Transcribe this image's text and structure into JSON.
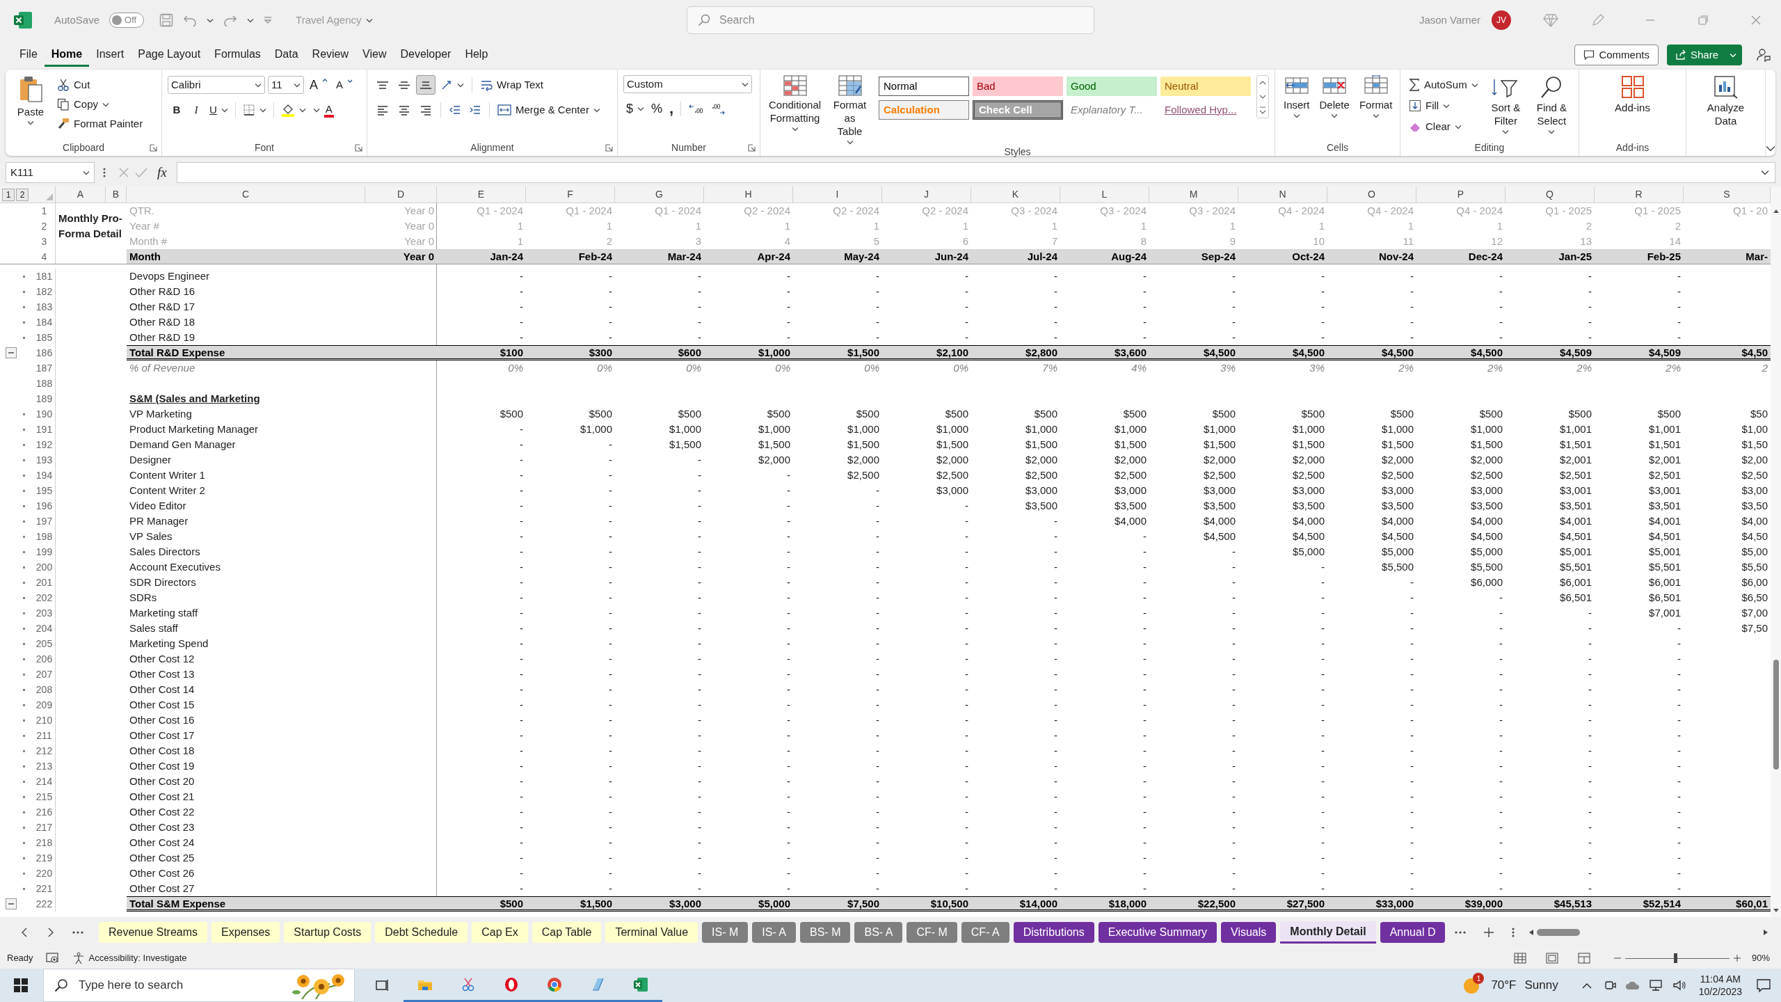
{
  "app": {
    "autosave": {
      "label": "AutoSave",
      "on": false,
      "state_text": "Off"
    },
    "document_title": "Travel Agency",
    "search_placeholder": "Search",
    "user_name": "Jason Varner",
    "user_initials": "JV"
  },
  "menu_tabs": [
    {
      "label": "File",
      "selected": false
    },
    {
      "label": "Home",
      "selected": true
    },
    {
      "label": "Insert",
      "selected": false
    },
    {
      "label": "Page Layout",
      "selected": false
    },
    {
      "label": "Formulas",
      "selected": false
    },
    {
      "label": "Data",
      "selected": false
    },
    {
      "label": "Review",
      "selected": false
    },
    {
      "label": "View",
      "selected": false
    },
    {
      "label": "Developer",
      "selected": false
    },
    {
      "label": "Help",
      "selected": false
    }
  ],
  "comments_button": "Comments",
  "share_button": "Share",
  "ribbon": {
    "clipboard": {
      "label": "Clipboard",
      "paste": "Paste",
      "cut": "Cut",
      "copy": "Copy",
      "format_painter": "Format Painter"
    },
    "font": {
      "label": "Font",
      "font_name": "Calibri",
      "font_size": "11",
      "grow": "A",
      "shrink": "A",
      "bold": "B",
      "italic": "I",
      "underline": "U",
      "font_color": "A"
    },
    "alignment": {
      "label": "Alignment",
      "vertical_align": [
        {
          "selected": false
        },
        {
          "selected": false
        },
        {
          "selected": true
        }
      ],
      "wrap_text": "Wrap Text",
      "merge_center": "Merge & Center"
    },
    "number": {
      "label": "Number",
      "format": "Custom",
      "currency": "$",
      "percent": "%",
      "comma": ","
    },
    "styles": {
      "label": "Styles",
      "conditional_formatting": "Conditional Formatting",
      "format_as_table": "Format as Table",
      "gallery": [
        {
          "kind": "normal",
          "label": "Normal"
        },
        {
          "kind": "bad",
          "label": "Bad"
        },
        {
          "kind": "good",
          "label": "Good"
        },
        {
          "kind": "neutral",
          "label": "Neutral"
        },
        {
          "kind": "calculation",
          "label": "Calculation"
        },
        {
          "kind": "check",
          "label": "Check Cell"
        },
        {
          "kind": "explanatory",
          "label": "Explanatory T..."
        },
        {
          "kind": "hyperlink",
          "label": "Followed Hyp..."
        }
      ]
    },
    "cells": {
      "label": "Cells",
      "insert": "Insert",
      "delete": "Delete",
      "format": "Format"
    },
    "editing": {
      "label": "Editing",
      "autosum": "AutoSum",
      "fill": "Fill",
      "clear": "Clear",
      "sort_filter": "Sort & Filter",
      "find_select": "Find & Select"
    },
    "addins": {
      "label": "Add-ins",
      "addins": "Add-ins"
    },
    "analyze_data": "Analyze Data"
  },
  "formula_bar": {
    "name_box": "K111",
    "fx": "fx"
  },
  "outline_levels": [
    "1",
    "2"
  ],
  "columns": [
    "A",
    "B",
    "C",
    "D",
    "E",
    "F",
    "G",
    "H",
    "I",
    "J",
    "K",
    "L",
    "M",
    "N",
    "O",
    "P",
    "Q",
    "R",
    "S"
  ],
  "title_cell": "Monthly Pro-Forma Detail",
  "header_rows": [
    {
      "num": "1",
      "kind": "meta",
      "label": "QTR.",
      "d": "Year 0",
      "values": [
        "Q1 - 2024",
        "Q1 - 2024",
        "Q1 - 2024",
        "Q2 - 2024",
        "Q2 - 2024",
        "Q2 - 2024",
        "Q3 - 2024",
        "Q3 - 2024",
        "Q3 - 2024",
        "Q4 - 2024",
        "Q4 - 2024",
        "Q4 - 2024",
        "Q1 - 2025",
        "Q1 - 2025",
        "Q1 - 20"
      ]
    },
    {
      "num": "2",
      "kind": "meta",
      "label": "Year #",
      "d": "Year 0",
      "values": [
        "1",
        "1",
        "1",
        "1",
        "1",
        "1",
        "1",
        "1",
        "1",
        "1",
        "1",
        "1",
        "2",
        "2"
      ]
    },
    {
      "num": "3",
      "kind": "meta",
      "label": "Month #",
      "d": "Year 0",
      "values": [
        "1",
        "2",
        "3",
        "4",
        "5",
        "6",
        "7",
        "8",
        "9",
        "10",
        "11",
        "12",
        "13",
        "14"
      ]
    },
    {
      "num": "4",
      "kind": "month",
      "label": "Month",
      "d": "Year 0",
      "values": [
        "Jan-24",
        "Feb-24",
        "Mar-24",
        "Apr-24",
        "May-24",
        "Jun-24",
        "Jul-24",
        "Aug-24",
        "Sep-24",
        "Oct-24",
        "Nov-24",
        "Dec-24",
        "Jan-25",
        "Feb-25",
        "Mar-"
      ]
    }
  ],
  "rows": [
    {
      "num": "181",
      "kind": "item",
      "grouped": true,
      "collapse_button": false,
      "label": "Devops Engineer",
      "values": [
        "-",
        "-",
        "-",
        "-",
        "-",
        "-",
        "-",
        "-",
        "-",
        "-",
        "-",
        "-",
        "-",
        "-"
      ]
    },
    {
      "num": "182",
      "kind": "item",
      "grouped": true,
      "collapse_button": false,
      "label": "Other R&D 16",
      "values": [
        "-",
        "-",
        "-",
        "-",
        "-",
        "-",
        "-",
        "-",
        "-",
        "-",
        "-",
        "-",
        "-",
        "-"
      ]
    },
    {
      "num": "183",
      "kind": "item",
      "grouped": true,
      "collapse_button": false,
      "label": "Other R&D 17",
      "values": [
        "-",
        "-",
        "-",
        "-",
        "-",
        "-",
        "-",
        "-",
        "-",
        "-",
        "-",
        "-",
        "-",
        "-"
      ]
    },
    {
      "num": "184",
      "kind": "item",
      "grouped": true,
      "collapse_button": false,
      "label": "Other R&D 18",
      "values": [
        "-",
        "-",
        "-",
        "-",
        "-",
        "-",
        "-",
        "-",
        "-",
        "-",
        "-",
        "-",
        "-",
        "-"
      ]
    },
    {
      "num": "185",
      "kind": "item",
      "grouped": true,
      "collapse_button": false,
      "label": "Other R&D 19",
      "values": [
        "-",
        "-",
        "-",
        "-",
        "-",
        "-",
        "-",
        "-",
        "-",
        "-",
        "-",
        "-",
        "-",
        "-"
      ]
    },
    {
      "num": "186",
      "kind": "total",
      "grouped": false,
      "collapse_button": true,
      "label": "Total R&D Expense",
      "values": [
        "$100",
        "$300",
        "$600",
        "$1,000",
        "$1,500",
        "$2,100",
        "$2,800",
        "$3,600",
        "$4,500",
        "$4,500",
        "$4,500",
        "$4,500",
        "$4,509",
        "$4,509",
        "$4,50"
      ]
    },
    {
      "num": "187",
      "kind": "percent",
      "grouped": false,
      "collapse_button": false,
      "label": "% of Revenue",
      "values": [
        "0%",
        "0%",
        "0%",
        "0%",
        "0%",
        "0%",
        "7%",
        "4%",
        "3%",
        "3%",
        "2%",
        "2%",
        "2%",
        "2%",
        "2"
      ]
    },
    {
      "num": "188",
      "kind": "blank",
      "grouped": false,
      "collapse_button": false
    },
    {
      "num": "189",
      "kind": "section",
      "grouped": false,
      "collapse_button": false,
      "label": "S&M (Sales and Marketing"
    },
    {
      "num": "190",
      "kind": "item",
      "grouped": true,
      "collapse_button": false,
      "label": "VP Marketing",
      "values": [
        "$500",
        "$500",
        "$500",
        "$500",
        "$500",
        "$500",
        "$500",
        "$500",
        "$500",
        "$500",
        "$500",
        "$500",
        "$500",
        "$500",
        "$50"
      ]
    },
    {
      "num": "191",
      "kind": "item",
      "grouped": true,
      "collapse_button": false,
      "label": "Product Marketing Manager",
      "values": [
        "-",
        "$1,000",
        "$1,000",
        "$1,000",
        "$1,000",
        "$1,000",
        "$1,000",
        "$1,000",
        "$1,000",
        "$1,000",
        "$1,000",
        "$1,000",
        "$1,001",
        "$1,001",
        "$1,00"
      ]
    },
    {
      "num": "192",
      "kind": "item",
      "grouped": true,
      "collapse_button": false,
      "label": "Demand Gen Manager",
      "values": [
        "-",
        "-",
        "$1,500",
        "$1,500",
        "$1,500",
        "$1,500",
        "$1,500",
        "$1,500",
        "$1,500",
        "$1,500",
        "$1,500",
        "$1,500",
        "$1,501",
        "$1,501",
        "$1,50"
      ]
    },
    {
      "num": "193",
      "kind": "item",
      "grouped": true,
      "collapse_button": false,
      "label": "Designer",
      "values": [
        "-",
        "-",
        "-",
        "$2,000",
        "$2,000",
        "$2,000",
        "$2,000",
        "$2,000",
        "$2,000",
        "$2,000",
        "$2,000",
        "$2,000",
        "$2,001",
        "$2,001",
        "$2,00"
      ]
    },
    {
      "num": "194",
      "kind": "item",
      "grouped": true,
      "collapse_button": false,
      "label": "Content Writer 1",
      "values": [
        "-",
        "-",
        "-",
        "-",
        "$2,500",
        "$2,500",
        "$2,500",
        "$2,500",
        "$2,500",
        "$2,500",
        "$2,500",
        "$2,500",
        "$2,501",
        "$2,501",
        "$2,50"
      ]
    },
    {
      "num": "195",
      "kind": "item",
      "grouped": true,
      "collapse_button": false,
      "label": "Content Writer 2",
      "values": [
        "-",
        "-",
        "-",
        "-",
        "-",
        "$3,000",
        "$3,000",
        "$3,000",
        "$3,000",
        "$3,000",
        "$3,000",
        "$3,000",
        "$3,001",
        "$3,001",
        "$3,00"
      ]
    },
    {
      "num": "196",
      "kind": "item",
      "grouped": true,
      "collapse_button": false,
      "label": "Video Editor",
      "values": [
        "-",
        "-",
        "-",
        "-",
        "-",
        "-",
        "$3,500",
        "$3,500",
        "$3,500",
        "$3,500",
        "$3,500",
        "$3,500",
        "$3,501",
        "$3,501",
        "$3,50"
      ]
    },
    {
      "num": "197",
      "kind": "item",
      "grouped": true,
      "collapse_button": false,
      "label": "PR Manager",
      "values": [
        "-",
        "-",
        "-",
        "-",
        "-",
        "-",
        "-",
        "$4,000",
        "$4,000",
        "$4,000",
        "$4,000",
        "$4,000",
        "$4,001",
        "$4,001",
        "$4,00"
      ]
    },
    {
      "num": "198",
      "kind": "item",
      "grouped": true,
      "collapse_button": false,
      "label": "VP Sales",
      "values": [
        "-",
        "-",
        "-",
        "-",
        "-",
        "-",
        "-",
        "-",
        "$4,500",
        "$4,500",
        "$4,500",
        "$4,500",
        "$4,501",
        "$4,501",
        "$4,50"
      ]
    },
    {
      "num": "199",
      "kind": "item",
      "grouped": true,
      "collapse_button": false,
      "label": "Sales Directors",
      "values": [
        "-",
        "-",
        "-",
        "-",
        "-",
        "-",
        "-",
        "-",
        "-",
        "$5,000",
        "$5,000",
        "$5,000",
        "$5,001",
        "$5,001",
        "$5,00"
      ]
    },
    {
      "num": "200",
      "kind": "item",
      "grouped": true,
      "collapse_button": false,
      "label": "Account Executives",
      "values": [
        "-",
        "-",
        "-",
        "-",
        "-",
        "-",
        "-",
        "-",
        "-",
        "-",
        "$5,500",
        "$5,500",
        "$5,501",
        "$5,501",
        "$5,50"
      ]
    },
    {
      "num": "201",
      "kind": "item",
      "grouped": true,
      "collapse_button": false,
      "label": "SDR Directors",
      "values": [
        "-",
        "-",
        "-",
        "-",
        "-",
        "-",
        "-",
        "-",
        "-",
        "-",
        "-",
        "$6,000",
        "$6,001",
        "$6,001",
        "$6,00"
      ]
    },
    {
      "num": "202",
      "kind": "item",
      "grouped": true,
      "collapse_button": false,
      "label": "SDRs",
      "values": [
        "-",
        "-",
        "-",
        "-",
        "-",
        "-",
        "-",
        "-",
        "-",
        "-",
        "-",
        "-",
        "$6,501",
        "$6,501",
        "$6,50"
      ]
    },
    {
      "num": "203",
      "kind": "item",
      "grouped": true,
      "collapse_button": false,
      "label": "Marketing staff",
      "values": [
        "-",
        "-",
        "-",
        "-",
        "-",
        "-",
        "-",
        "-",
        "-",
        "-",
        "-",
        "-",
        "-",
        "$7,001",
        "$7,00"
      ]
    },
    {
      "num": "204",
      "kind": "item",
      "grouped": true,
      "collapse_button": false,
      "label": "Sales staff",
      "values": [
        "-",
        "-",
        "-",
        "-",
        "-",
        "-",
        "-",
        "-",
        "-",
        "-",
        "-",
        "-",
        "-",
        "-",
        "$7,50"
      ]
    },
    {
      "num": "205",
      "kind": "item",
      "grouped": true,
      "collapse_button": false,
      "label": "Marketing Spend",
      "values": [
        "-",
        "-",
        "-",
        "-",
        "-",
        "-",
        "-",
        "-",
        "-",
        "-",
        "-",
        "-",
        "-",
        "-"
      ]
    },
    {
      "num": "206",
      "kind": "item",
      "grouped": true,
      "collapse_button": false,
      "label": "Other Cost 12",
      "values": [
        "-",
        "-",
        "-",
        "-",
        "-",
        "-",
        "-",
        "-",
        "-",
        "-",
        "-",
        "-",
        "-",
        "-"
      ]
    },
    {
      "num": "207",
      "kind": "item",
      "grouped": true,
      "collapse_button": false,
      "label": "Other Cost 13",
      "values": [
        "-",
        "-",
        "-",
        "-",
        "-",
        "-",
        "-",
        "-",
        "-",
        "-",
        "-",
        "-",
        "-",
        "-"
      ]
    },
    {
      "num": "208",
      "kind": "item",
      "grouped": true,
      "collapse_button": false,
      "label": "Other Cost 14",
      "values": [
        "-",
        "-",
        "-",
        "-",
        "-",
        "-",
        "-",
        "-",
        "-",
        "-",
        "-",
        "-",
        "-",
        "-"
      ]
    },
    {
      "num": "209",
      "kind": "item",
      "grouped": true,
      "collapse_button": false,
      "label": "Other Cost 15",
      "values": [
        "-",
        "-",
        "-",
        "-",
        "-",
        "-",
        "-",
        "-",
        "-",
        "-",
        "-",
        "-",
        "-",
        "-"
      ]
    },
    {
      "num": "210",
      "kind": "item",
      "grouped": true,
      "collapse_button": false,
      "label": "Other Cost 16",
      "values": [
        "-",
        "-",
        "-",
        "-",
        "-",
        "-",
        "-",
        "-",
        "-",
        "-",
        "-",
        "-",
        "-",
        "-"
      ]
    },
    {
      "num": "211",
      "kind": "item",
      "grouped": true,
      "collapse_button": false,
      "label": "Other Cost 17",
      "values": [
        "-",
        "-",
        "-",
        "-",
        "-",
        "-",
        "-",
        "-",
        "-",
        "-",
        "-",
        "-",
        "-",
        "-"
      ]
    },
    {
      "num": "212",
      "kind": "item",
      "grouped": true,
      "collapse_button": false,
      "label": "Other Cost 18",
      "values": [
        "-",
        "-",
        "-",
        "-",
        "-",
        "-",
        "-",
        "-",
        "-",
        "-",
        "-",
        "-",
        "-",
        "-"
      ]
    },
    {
      "num": "213",
      "kind": "item",
      "grouped": true,
      "collapse_button": false,
      "label": "Other Cost 19",
      "values": [
        "-",
        "-",
        "-",
        "-",
        "-",
        "-",
        "-",
        "-",
        "-",
        "-",
        "-",
        "-",
        "-",
        "-"
      ]
    },
    {
      "num": "214",
      "kind": "item",
      "grouped": true,
      "collapse_button": false,
      "label": "Other Cost 20",
      "values": [
        "-",
        "-",
        "-",
        "-",
        "-",
        "-",
        "-",
        "-",
        "-",
        "-",
        "-",
        "-",
        "-",
        "-"
      ]
    },
    {
      "num": "215",
      "kind": "item",
      "grouped": true,
      "collapse_button": false,
      "label": "Other Cost 21",
      "values": [
        "-",
        "-",
        "-",
        "-",
        "-",
        "-",
        "-",
        "-",
        "-",
        "-",
        "-",
        "-",
        "-",
        "-"
      ]
    },
    {
      "num": "216",
      "kind": "item",
      "grouped": true,
      "collapse_button": false,
      "label": "Other Cost 22",
      "values": [
        "-",
        "-",
        "-",
        "-",
        "-",
        "-",
        "-",
        "-",
        "-",
        "-",
        "-",
        "-",
        "-",
        "-"
      ]
    },
    {
      "num": "217",
      "kind": "item",
      "grouped": true,
      "collapse_button": false,
      "label": "Other Cost 23",
      "values": [
        "-",
        "-",
        "-",
        "-",
        "-",
        "-",
        "-",
        "-",
        "-",
        "-",
        "-",
        "-",
        "-",
        "-"
      ]
    },
    {
      "num": "218",
      "kind": "item",
      "grouped": true,
      "collapse_button": false,
      "label": "Other Cost 24",
      "values": [
        "-",
        "-",
        "-",
        "-",
        "-",
        "-",
        "-",
        "-",
        "-",
        "-",
        "-",
        "-",
        "-",
        "-"
      ]
    },
    {
      "num": "219",
      "kind": "item",
      "grouped": true,
      "collapse_button": false,
      "label": "Other Cost 25",
      "values": [
        "-",
        "-",
        "-",
        "-",
        "-",
        "-",
        "-",
        "-",
        "-",
        "-",
        "-",
        "-",
        "-",
        "-"
      ]
    },
    {
      "num": "220",
      "kind": "item",
      "grouped": true,
      "collapse_button": false,
      "label": "Other Cost 26",
      "values": [
        "-",
        "-",
        "-",
        "-",
        "-",
        "-",
        "-",
        "-",
        "-",
        "-",
        "-",
        "-",
        "-",
        "-"
      ]
    },
    {
      "num": "221",
      "kind": "item",
      "grouped": true,
      "collapse_button": false,
      "label": "Other Cost 27",
      "values": [
        "-",
        "-",
        "-",
        "-",
        "-",
        "-",
        "-",
        "-",
        "-",
        "-",
        "-",
        "-",
        "-",
        "-"
      ]
    },
    {
      "num": "222",
      "kind": "total",
      "grouped": false,
      "collapse_button": true,
      "label": "Total S&M Expense",
      "values": [
        "$500",
        "$1,500",
        "$3,000",
        "$5,000",
        "$7,500",
        "$10,500",
        "$14,000",
        "$18,000",
        "$22,500",
        "$27,500",
        "$33,000",
        "$39,000",
        "$45,513",
        "$52,514",
        "$60,01"
      ]
    }
  ],
  "sheet_tabs": [
    {
      "label": "Revenue Streams",
      "color": "#ffffcc",
      "selected": false
    },
    {
      "label": "Expenses",
      "color": "#ffffcc",
      "selected": false
    },
    {
      "label": "Startup Costs",
      "color": "#ffffcc",
      "selected": false
    },
    {
      "label": "Debt Schedule",
      "color": "#ffffcc",
      "selected": false
    },
    {
      "label": "Cap Ex",
      "color": "#ffffcc",
      "selected": false
    },
    {
      "label": "Cap Table",
      "color": "#ffffcc",
      "selected": false
    },
    {
      "label": "Terminal Value",
      "color": "#ffffcc",
      "selected": false
    },
    {
      "label": "IS- M",
      "color": "#7f7f7f",
      "selected": false
    },
    {
      "label": "IS- A",
      "color": "#7f7f7f",
      "selected": false
    },
    {
      "label": "BS- M",
      "color": "#7f7f7f",
      "selected": false
    },
    {
      "label": "BS- A",
      "color": "#7f7f7f",
      "selected": false
    },
    {
      "label": "CF- M",
      "color": "#7f7f7f",
      "selected": false
    },
    {
      "label": "CF- A",
      "color": "#7f7f7f",
      "selected": false
    },
    {
      "label": "Distributions",
      "color": "#7030a0",
      "selected": false
    },
    {
      "label": "Executive Summary",
      "color": "#7030a0",
      "selected": false
    },
    {
      "label": "Visuals",
      "color": "#7030a0",
      "selected": false
    },
    {
      "label": "Monthly Detail",
      "color": "#7030a0",
      "selected": true
    },
    {
      "label": "Annual D",
      "color": "#7030a0",
      "selected": false
    }
  ],
  "status_bar": {
    "ready": "Ready",
    "accessibility": "Accessibility: Investigate",
    "zoom": "90%",
    "zoom_slider": {
      "level": 0.47
    }
  },
  "taskbar": {
    "search_placeholder": "Type here to search",
    "weather_badge": "1",
    "temperature": "70°F",
    "condition": "Sunny",
    "time": "11:04 AM",
    "date": "10/2/2023"
  }
}
